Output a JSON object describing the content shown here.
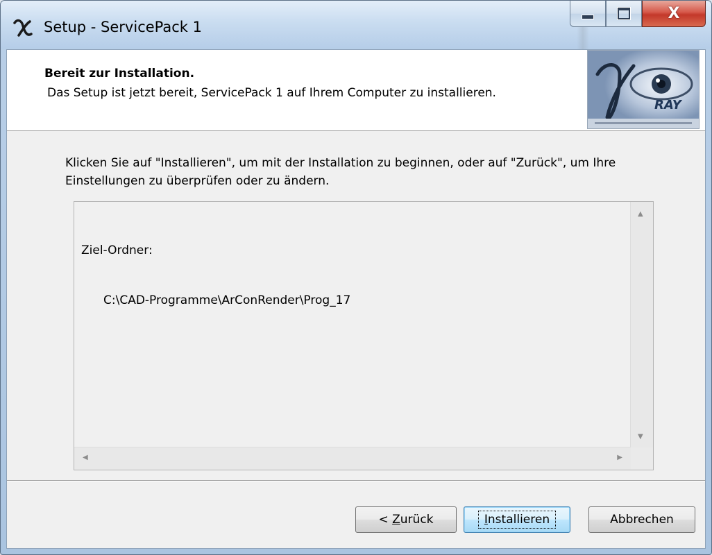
{
  "window": {
    "title": "Setup - ServicePack 1",
    "close_glyph": "X"
  },
  "header": {
    "title": "Bereit zur Installation.",
    "subtitle": "Das Setup ist jetzt bereit, ServicePack 1 auf Ihrem Computer zu installieren.",
    "logo_text": "RAY"
  },
  "body": {
    "instruction": "Klicken Sie auf \"Installieren\", um mit der Installation zu beginnen, oder auf \"Zurück\", um Ihre Einstellungen zu überprüfen oder zu ändern."
  },
  "memo": {
    "label": "Ziel-Ordner:",
    "path": "C:\\CAD-Programme\\ArConRender\\Prog_17"
  },
  "buttons": {
    "back_prefix": "< ",
    "back_accel": "Z",
    "back_rest": "urück",
    "install_accel": "I",
    "install_rest": "nstallieren",
    "cancel": "Abbrechen"
  },
  "colors": {
    "accent_default_button": "#3c7fb1",
    "close_button": "#c3382a"
  }
}
